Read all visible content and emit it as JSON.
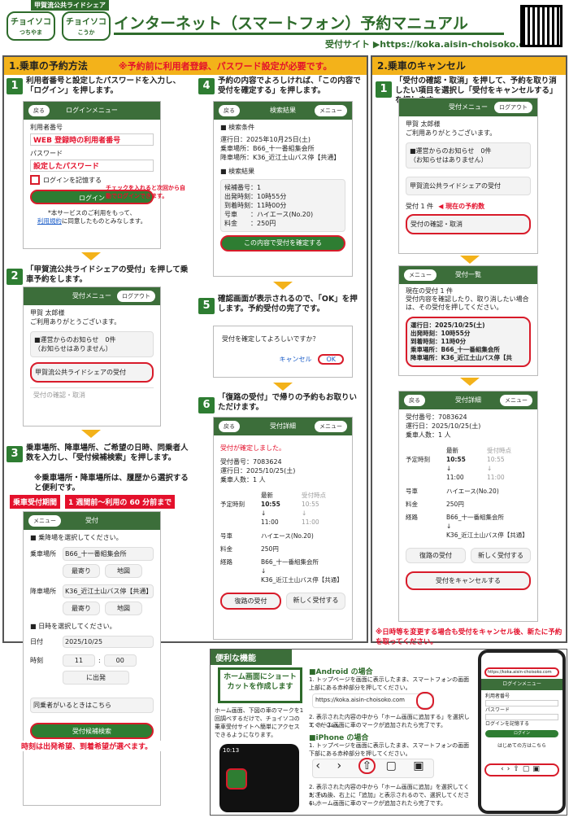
{
  "header": {
    "brand": "甲賀流公共ライドシェア",
    "logo1": "チョイソコ",
    "logo1_sub": "つちやま",
    "logo2": "チョイソコ",
    "logo2_sub": "こうか",
    "title": "インターネット（スマートフォン）予約マニュアル",
    "site": "受付サイト ▶https://koka.aisin-choisoko.com"
  },
  "sec1": {
    "heading": "1.乗車の予約方法",
    "notice": "※予約前に利用者登録、パスワード設定が必要です。",
    "s1": "利用者番号と設定したパスワードを入力し、「ログイン」を押します。",
    "s2": "「甲賀流公共ライドシェアの受付」を押して乗車予約をします。",
    "s3": "乗車場所、降車場所、ご希望の日時、同乗者人数を入力し、「受付候補検索」を押します。",
    "s3_note": "※乗車場所・降車場所は、履歴から選択すると便利です。",
    "period_label": "乗車受付期間",
    "period_value": "1 週間前～利用の 60 分前まで",
    "s4": "予約の内容でよろしければ、「この内容で受付を確定する」を押します。",
    "s5": "確認画面が表示されるので、「OK」を押します。予約受付の完了です。",
    "s6": "「復路の受付」で帰りの予約もお取りいただけます。"
  },
  "sec2": {
    "heading": "2.乗車のキャンセル",
    "s1": "「受付の確認・取消」を押して、予約を取り消したい項目を選択し「受付をキャンセルする」を押します。",
    "note": "※日時等を変更する場合も受付をキャンセル後、新たに予約を取ってください。",
    "current": "◀ 現在の予約数"
  },
  "login": {
    "back": "戻る",
    "title": "ログインメニュー",
    "id_label": "利用者番号",
    "id_value": "WEB 登録時の利用者番号",
    "pw_label": "パスワード",
    "pw_value": "設定したパスワード",
    "remember": "ログインを記憶する",
    "remember_note": "チェックを入れると次回から自動でログインできます。",
    "btn": "ログイン",
    "terms1": "*本サービスのご利用をもって、",
    "terms_link": "利用規約",
    "terms2": "に同意したものとみなします。"
  },
  "menu": {
    "title": "受付メニュー",
    "logout": "ログアウト",
    "name": "甲賀 太郎様",
    "welcome": "ご利用ありがとうございます。",
    "info": "■運営からのお知らせ　0件",
    "info_sub": "（お知らせはありません）",
    "ride": "甲賀流公共ライドシェアの受付",
    "check": "受付の確認・取消",
    "count": "受付 1 件"
  },
  "booking": {
    "menu": "メニュー",
    "title": "受付",
    "stop_head": "■ 乗降場を選択してください。",
    "pickup_label": "乗車場所",
    "pickup": "B66_十一番組集会所",
    "near": "最寄り",
    "map": "地図",
    "drop_label": "降車場所",
    "drop": "K36_近江土山バス停【共通】",
    "date_head": "■ 日時を選択してください。",
    "date_label": "日付",
    "date": "2025/10/25",
    "time_label": "時刻",
    "hour": "11",
    "min": "00",
    "dep": "に出発",
    "time_note": "時刻は出発希望、到着希望が選べます。",
    "companion": "同乗者がいるときはこちら",
    "search": "受付候補検索"
  },
  "result": {
    "title": "検索結果",
    "cond": "■ 検索条件",
    "d_label": "運行日",
    "d": "：2025年10月25日(土)",
    "p_label": "乗車場所",
    "p": "：B66_十一番組集会所",
    "q_label": "降車場所",
    "q": "：K36_近江土山バス停【共通】",
    "res": "■ 検索結果",
    "c1": "候補番号：1",
    "c2": "出発時刻：10時55分",
    "c3": "到着時刻：11時00分",
    "c4": "号車　　：ハイエース(No.20)",
    "c5": "料金　　：250円",
    "confirm": "この内容で受付を確定する"
  },
  "dialog": {
    "msg": "受付を確定してよろしいですか？",
    "cancel": "キャンセル",
    "ok": "OK"
  },
  "detail": {
    "title": "受付詳細",
    "done": "受付が確定しました。",
    "no": "受付番号：7083624",
    "date": "運行日：2025/10/25(土)",
    "people": "乗車人数：1 人",
    "latest": "最新",
    "point": "受付時点",
    "sched": "予定時刻",
    "t1": "10:55",
    "t2": "11:00",
    "car_label": "号車",
    "car": "ハイエース(No.20)",
    "fee_label": "料金",
    "fee": "250円",
    "route_label": "経路",
    "r1": "B66_十一番組集会所",
    "r2": "K36_近江土山バス停【共通】",
    "ret": "復路の受付",
    "new": "新しく受付する",
    "cancel": "受付をキャンセルする"
  },
  "list": {
    "title": "受付一覧",
    "l1": "現在の受付 1 件",
    "l2": "受付内容を確認したり、取り消したい場合は、その受付を押してください。",
    "i1": "運行日：2025/10/25(土)",
    "i2": "出発時刻：10時55分",
    "i3": "到着時刻：11時0分",
    "i4": "乗車場所：B66_十一番組集会所",
    "i5": "降車場所：K36_近江土山バス停【共"
  },
  "tips": {
    "heading": "便利な機能",
    "box": "ホーム画面にショートカットを作成します",
    "desc": "ホーム画面、下図の車のマークを1回調べするだけで、チョイソコの乗車受付サイトへ簡単にアクセスできるようになります。",
    "android": "■Android の場合",
    "a1": "1. トップページを画面に表示したまま、スマートフォンの画面上部にある赤枠部分を押してください。",
    "url": "https://koka.aisin-choisoko.com",
    "a2": "2. 表示された内容の中から「ホーム画面に追加する」を選択してください。",
    "a3": "3. ホーム画面に車のマークが追加されたら完了です。",
    "iphone": "■iPhone の場合",
    "i1": "1. トップページを画面に表示したまま、スマートフォンの画面下部にある赤枠部分を押してください。",
    "i2": "2. 表示された内容の中から「ホーム画面に追加」を選択してください。",
    "i3": "3. その後、右上に「追加」と表示されるので、選択してください。",
    "i4": "4. ホーム画面に車のマークが追加されたら完了です。",
    "clock": "10:13",
    "first": "はじめての方はこちら"
  }
}
